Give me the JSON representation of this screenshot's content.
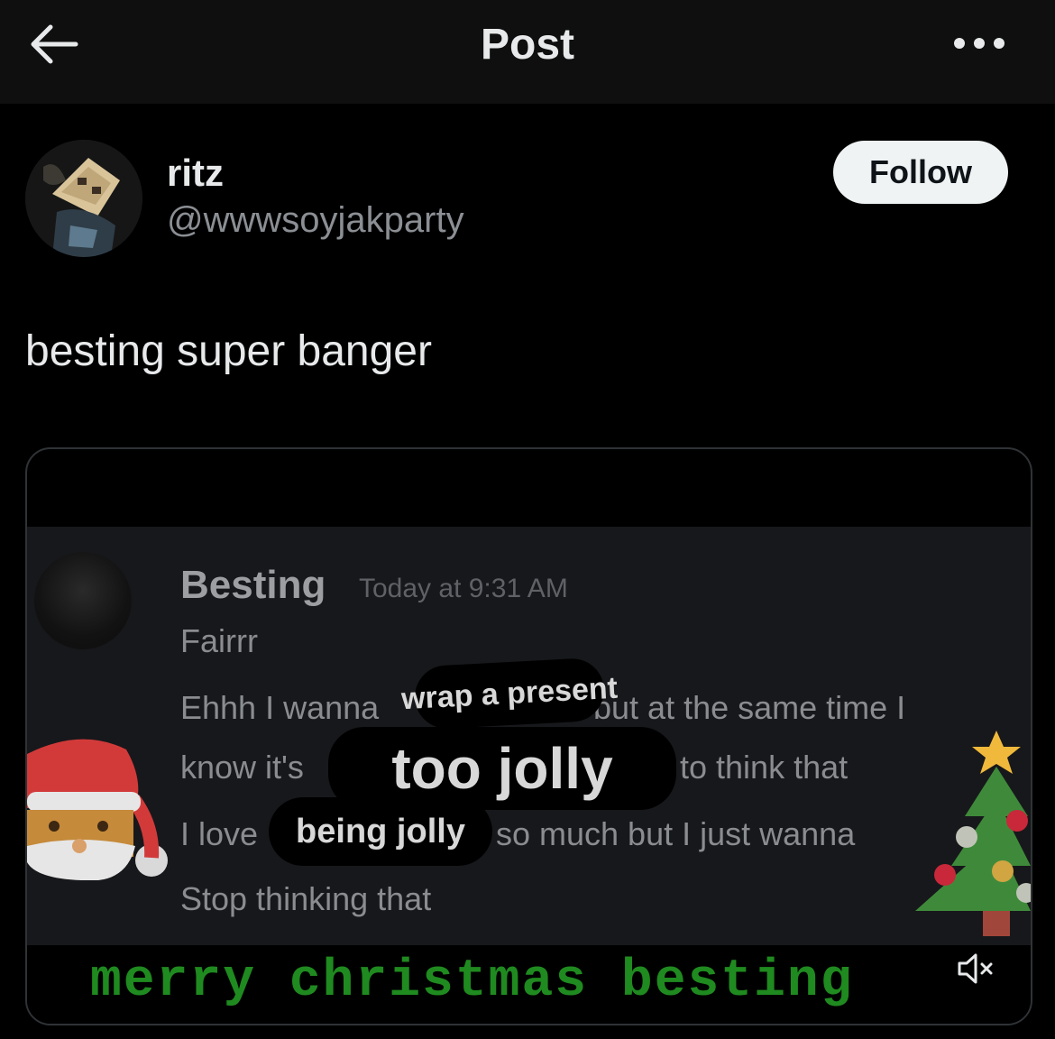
{
  "header": {
    "title": "Post",
    "back_icon": "arrow-left-icon",
    "more_icon": "more-horizontal-icon"
  },
  "author": {
    "name": "ritz",
    "handle": "@wwwsoyjakparty",
    "follow_label": "Follow"
  },
  "post": {
    "text": "besting super banger"
  },
  "media": {
    "message": {
      "author": "Besting",
      "timestamp": "Today at 9:31 AM",
      "lines": [
        "Fairrr",
        "Ehhh I wanna",
        "but at the same time I",
        "know it's",
        "to think that",
        "I love",
        "so much but I just wanna",
        "Stop thinking that"
      ]
    },
    "stickers": {
      "wrap": "wrap a present",
      "jolly": "too jolly",
      "being": "being jolly"
    },
    "caption": "merry christmas besting",
    "mute_icon": "volume-muted-icon"
  },
  "colors": {
    "background": "#000000",
    "header_bg": "#0f0f0f",
    "text": "#e7e9ea",
    "secondary": "#8b8f94",
    "follow_bg": "#eff3f4",
    "caption_green": "#1f8a1f"
  }
}
